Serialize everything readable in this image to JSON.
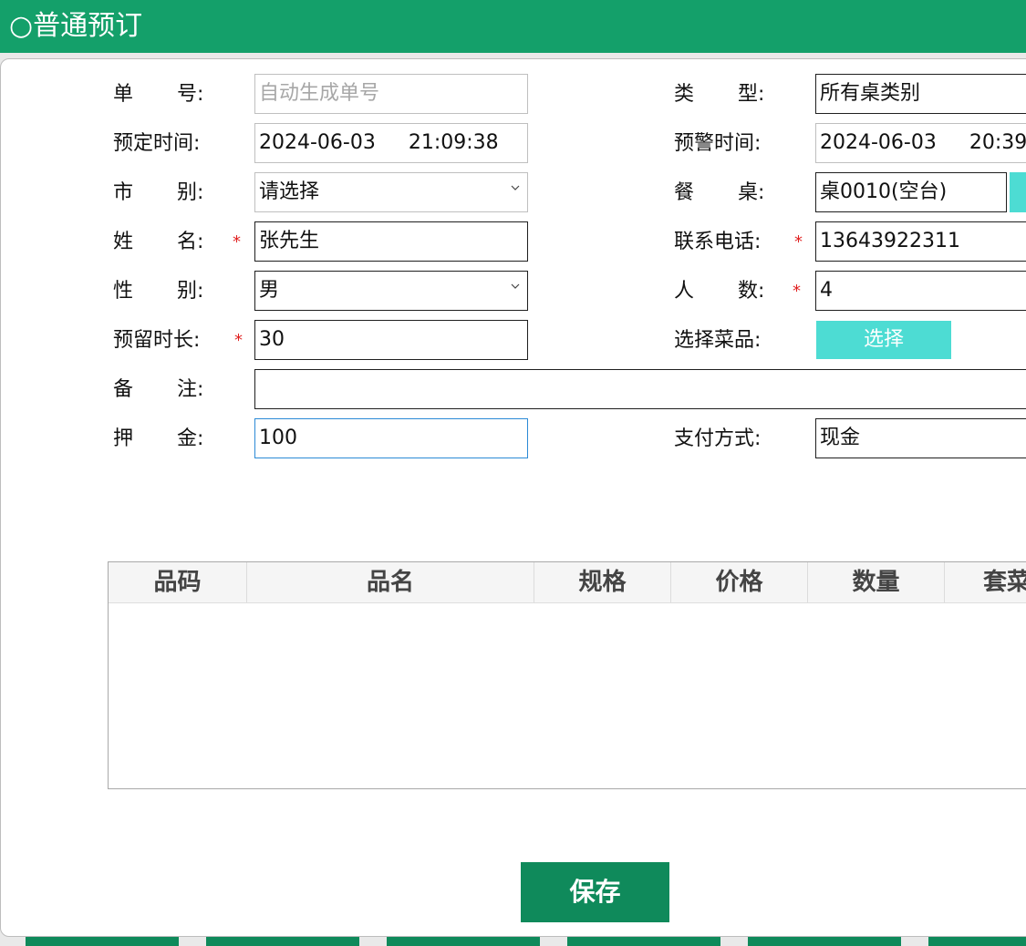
{
  "title": "○普通预订",
  "form": {
    "order_no": {
      "label": [
        "单",
        "号:"
      ],
      "placeholder": "自动生成单号"
    },
    "type": {
      "label": [
        "类",
        "型:"
      ],
      "value": "所有桌类别"
    },
    "book_time": {
      "label": "预定时间:",
      "date": "2024-06-03",
      "time": "21:09:38"
    },
    "alert_time": {
      "label": "预警时间:",
      "date": "2024-06-03",
      "time": "20:39"
    },
    "market": {
      "label": [
        "市",
        "别:"
      ],
      "value": "请选择"
    },
    "table": {
      "label": [
        "餐",
        "桌:"
      ],
      "value": "桌0010(空台)"
    },
    "name": {
      "label": [
        "姓",
        "名:"
      ],
      "value": "张先生",
      "required": "*"
    },
    "phone": {
      "label": "联系电话:",
      "value": "13643922311",
      "required": "*"
    },
    "gender": {
      "label": [
        "性",
        "别:"
      ],
      "value": "男"
    },
    "people": {
      "label": [
        "人",
        "数:"
      ],
      "value": "4",
      "required": "*"
    },
    "hold": {
      "label": "预留时长:",
      "value": "30",
      "required": "*"
    },
    "dishes": {
      "label": "选择菜品:",
      "button": "选择"
    },
    "remark": {
      "label": [
        "备",
        "注:"
      ],
      "value": ""
    },
    "deposit": {
      "label": [
        "押",
        "金:"
      ],
      "value": "100"
    },
    "pay": {
      "label": "支付方式:",
      "value": "现金"
    }
  },
  "grid": {
    "columns": [
      "品码",
      "品名",
      "规格",
      "价格",
      "数量",
      "套菜"
    ]
  },
  "save_label": "保存",
  "colors": {
    "header_green": "#14a06a",
    "button_green": "#0f8a5b",
    "teal": "#4ddcd3",
    "required": "#e02020"
  }
}
